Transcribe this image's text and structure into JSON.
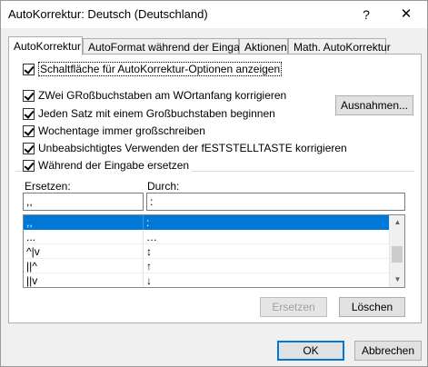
{
  "window": {
    "title": "AutoKorrektur: Deutsch (Deutschland)",
    "help_glyph": "?",
    "close_glyph": "✕"
  },
  "tabs": [
    {
      "label": "AutoKorrektur"
    },
    {
      "label": "AutoFormat während der Eingabe"
    },
    {
      "label": "Aktionen"
    },
    {
      "label": "Math. AutoKorrektur"
    }
  ],
  "options": {
    "show_buttons": "Schaltfläche für AutoKorrektur-Optionen anzeigen",
    "two_caps": "ZWei GRoßbuchstaben am WOrtanfang korrigieren",
    "sentence_caps": "Jeden Satz mit einem Großbuchstaben beginnen",
    "weekdays": "Wochentage immer großschreiben",
    "caps_lock": "Unbeabsichtigtes Verwenden der fESTSTELLTASTE korrigieren",
    "replace_typing": "Während der Eingabe ersetzen"
  },
  "exceptions_button": "Ausnahmen...",
  "replace": {
    "label_replace": "Ersetzen:",
    "label_with": "Durch:",
    "replace_value": ",,",
    "with_value": ":",
    "rows": [
      {
        "from": ",,",
        "to": ":"
      },
      {
        "from": "...",
        "to": "…"
      },
      {
        "from": "^|v",
        "to": "↕"
      },
      {
        "from": "||^",
        "to": "↑"
      },
      {
        "from": "||v",
        "to": "↓"
      }
    ],
    "selected_index": 0
  },
  "buttons": {
    "replace": "Ersetzen",
    "delete": "Löschen",
    "ok": "OK",
    "cancel": "Abbrechen"
  },
  "scroll": {
    "up_glyph": "▲",
    "down_glyph": "▼"
  },
  "colors": {
    "selection": "#0078d7",
    "default_button_border": "#0078d7"
  }
}
